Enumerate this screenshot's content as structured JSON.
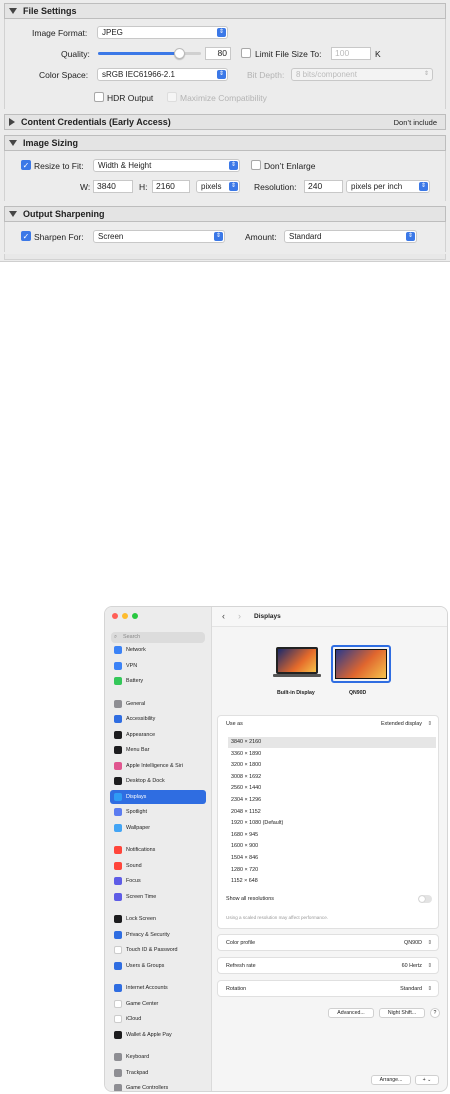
{
  "file_settings": {
    "title": "File Settings",
    "image_format_label": "Image Format:",
    "image_format_value": "JPEG",
    "quality_label": "Quality:",
    "quality_value": "80",
    "quality_fraction": 0.8,
    "limit_label": "Limit File Size To:",
    "limit_value": "100",
    "limit_unit": "K",
    "color_space_label": "Color Space:",
    "color_space_value": "sRGB IEC61966-2.1",
    "bit_depth_label": "Bit Depth:",
    "bit_depth_value": "8 bits/component",
    "hdr_label": "HDR Output",
    "max_compat_label": "Maximize Compatibility"
  },
  "content_credentials": {
    "title": "Content Credentials (Early Access)",
    "status": "Don’t include"
  },
  "image_sizing": {
    "title": "Image Sizing",
    "resize_label": "Resize to Fit:",
    "resize_value": "Width & Height",
    "dont_enlarge_label": "Don’t Enlarge",
    "w_label": "W:",
    "w_value": "3840",
    "h_label": "H:",
    "h_value": "2160",
    "unit_value": "pixels",
    "resolution_label": "Resolution:",
    "resolution_value": "240",
    "resolution_unit": "pixels per inch"
  },
  "output_sharpening": {
    "title": "Output Sharpening",
    "sharpen_label": "Sharpen For:",
    "sharpen_value": "Screen",
    "amount_label": "Amount:",
    "amount_value": "Standard"
  },
  "settings_window": {
    "title": "Displays",
    "search_placeholder": "Search",
    "sidebar": [
      {
        "label": "Network",
        "color": "#3b82f6",
        "group": 0
      },
      {
        "label": "VPN",
        "color": "#3b82f6",
        "group": 0
      },
      {
        "label": "Battery",
        "color": "#34c759",
        "group": 0
      },
      {
        "label": "General",
        "color": "#8e8e93",
        "group": 1
      },
      {
        "label": "Accessibility",
        "color": "#2f6de1",
        "group": 1
      },
      {
        "label": "Appearance",
        "color": "#1c1c1e",
        "group": 1
      },
      {
        "label": "Menu Bar",
        "color": "#1c1c1e",
        "group": 1
      },
      {
        "label": "Apple Intelligence & Siri",
        "color": "#e0568f",
        "group": 1
      },
      {
        "label": "Desktop & Dock",
        "color": "#1c1c1e",
        "group": 1
      },
      {
        "label": "Displays",
        "color": "#2f9bf5",
        "group": 1,
        "selected": true
      },
      {
        "label": "Spotlight",
        "color": "#5b7cf0",
        "group": 1
      },
      {
        "label": "Wallpaper",
        "color": "#43a5f5",
        "group": 1
      },
      {
        "label": "Notifications",
        "color": "#ff453a",
        "group": 2
      },
      {
        "label": "Sound",
        "color": "#ff453a",
        "group": 2
      },
      {
        "label": "Focus",
        "color": "#5e5ce6",
        "group": 2
      },
      {
        "label": "Screen Time",
        "color": "#5e5ce6",
        "group": 2
      },
      {
        "label": "Lock Screen",
        "color": "#1c1c1e",
        "group": 3
      },
      {
        "label": "Privacy & Security",
        "color": "#2f6de1",
        "group": 3
      },
      {
        "label": "Touch ID & Password",
        "color": "#ffffff",
        "group": 3
      },
      {
        "label": "Users & Groups",
        "color": "#2f6de1",
        "group": 3
      },
      {
        "label": "Internet Accounts",
        "color": "#2f6de1",
        "group": 4
      },
      {
        "label": "Game Center",
        "color": "#ffffff",
        "group": 4
      },
      {
        "label": "iCloud",
        "color": "#ffffff",
        "group": 4
      },
      {
        "label": "Wallet & Apple Pay",
        "color": "#1c1c1e",
        "group": 4
      },
      {
        "label": "Keyboard",
        "color": "#8e8e93",
        "group": 5
      },
      {
        "label": "Trackpad",
        "color": "#8e8e93",
        "group": 5
      },
      {
        "label": "Game Controllers",
        "color": "#8e8e93",
        "group": 5
      }
    ],
    "displays": [
      {
        "label": "Built-in Display"
      },
      {
        "label": "QN90D",
        "selected": true
      }
    ],
    "use_as_label": "Use as",
    "use_as_value": "Extended display",
    "resolutions": [
      "3840 × 2160",
      "3360 × 1890",
      "3200 × 1800",
      "3008 × 1692",
      "2560 × 1440",
      "2304 × 1296",
      "2048 × 1152",
      "1920 × 1080 (Default)",
      "1680 × 945",
      "1600 × 900",
      "1504 × 846",
      "1280 × 720",
      "1152 × 648"
    ],
    "selected_resolution": 0,
    "show_all_label": "Show all resolutions",
    "scaled_note": "Using a scaled resolution may affect performance.",
    "color_profile_label": "Color profile",
    "color_profile_value": "QN90D",
    "refresh_label": "Refresh rate",
    "refresh_value": "60 Hertz",
    "rotation_label": "Rotation",
    "rotation_value": "Standard",
    "advanced_label": "Advanced...",
    "night_shift_label": "Night Shift...",
    "help_label": "?",
    "arrange_label": "Arrange...",
    "add_label": "+"
  }
}
